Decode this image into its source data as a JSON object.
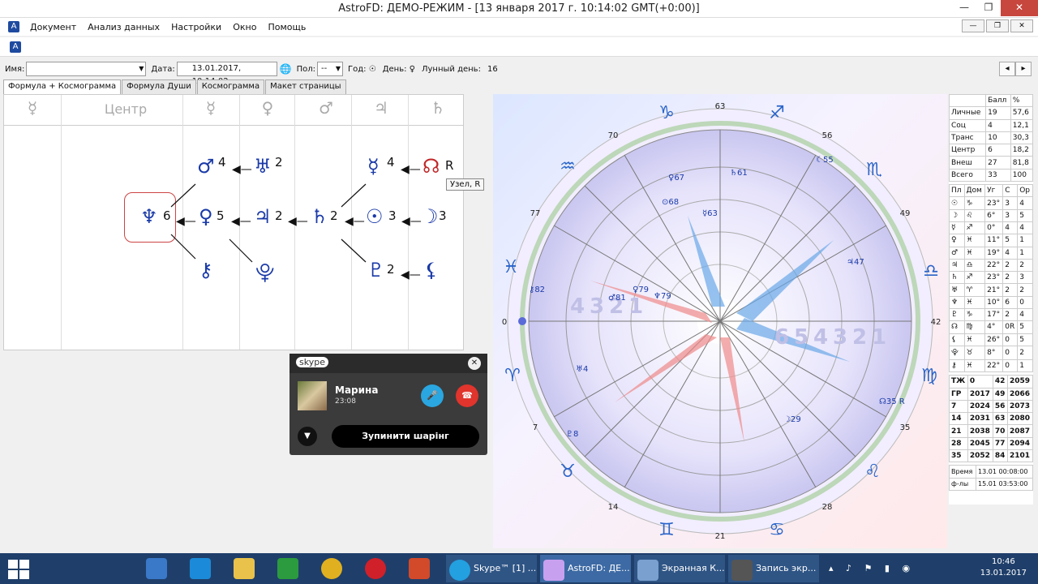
{
  "window": {
    "title": "AstroFD: ДЕМО-РЕЖИМ - [13 января 2017 г. 10:14:02 GMT(+0:00)]"
  },
  "menu": [
    "Документ",
    "Анализ данных",
    "Настройки",
    "Окно",
    "Помощь"
  ],
  "toolbar": {
    "name_label": "Имя:",
    "date_label": "Дата:",
    "date_value": "13.01.2017, 10:14:02",
    "sex_label": "Пол:",
    "sex_value": "--",
    "year_label": "Год: ☉",
    "day_label": "День: ♀",
    "lunar_label": "Лунный день:",
    "lunar_value": "16"
  },
  "tabs": [
    "Формула + Космограмма",
    "Формула Души",
    "Космограмма",
    "Макет страницы"
  ],
  "formula": {
    "columns": [
      "☿",
      "Центр",
      "☿",
      "♀",
      "♂",
      "♃",
      "♄"
    ],
    "nodes": [
      {
        "glyph": "♂",
        "num": "4"
      },
      {
        "glyph": "♅",
        "num": "2"
      },
      {
        "glyph": "☿",
        "num": "4"
      },
      {
        "glyph": "☊",
        "num": "R"
      },
      {
        "glyph": "♆",
        "num": "6"
      },
      {
        "glyph": "♀",
        "num": "5"
      },
      {
        "glyph": "♃",
        "num": "2"
      },
      {
        "glyph": "♄",
        "num": "2"
      },
      {
        "glyph": "☉",
        "num": "3"
      },
      {
        "glyph": "☽",
        "num": "3"
      },
      {
        "glyph": "⚷",
        "num": ""
      },
      {
        "glyph": "⯓",
        "num": ""
      },
      {
        "glyph": "♇",
        "num": "2"
      },
      {
        "glyph": "⚸",
        "num": ""
      }
    ],
    "tooltip": "Узел, R"
  },
  "skype": {
    "logo": "skype",
    "name": "Марина",
    "time": "23:08",
    "stop_button": "Зупинити шарінг"
  },
  "chart": {
    "ascendant_marks": [
      "63",
      "56",
      "49",
      "42",
      "35",
      "28",
      "21",
      "14",
      "7",
      "0",
      "77",
      "70"
    ],
    "house_digits_left": [
      "4",
      "3",
      "2",
      "1",
      "2",
      "3"
    ],
    "house_digits_right": [
      "6",
      "5",
      "4",
      "3",
      "2",
      "1"
    ],
    "planet_labels": [
      "♀67",
      "♄61",
      "⊙68",
      "☿63",
      "☾55",
      "⚷82",
      "♂81",
      "♀79",
      "♆79",
      "♃47",
      "♅4",
      "♇8",
      "☽29",
      "☊35 R"
    ]
  },
  "stats": {
    "headers": [
      "",
      "Балл",
      "%"
    ],
    "rows": [
      [
        "Личные",
        "19",
        "57,6"
      ],
      [
        "Соц",
        "4",
        "12,1"
      ],
      [
        "Транс",
        "10",
        "30,3"
      ],
      [
        "Центр",
        "6",
        "18,2"
      ],
      [
        "Внеш",
        "27",
        "81,8"
      ],
      [
        "Всего",
        "33",
        "100"
      ]
    ]
  },
  "planets": {
    "headers": [
      "Пл",
      "Дом",
      "Уг",
      "С",
      "Ор"
    ],
    "rows": [
      [
        "☉",
        "♑",
        "23°",
        "3",
        "4"
      ],
      [
        "☽",
        "♌",
        "6°",
        "3",
        "5"
      ],
      [
        "☿",
        "♐",
        "0°",
        "4",
        "4"
      ],
      [
        "♀",
        "♓",
        "11°",
        "5",
        "1"
      ],
      [
        "♂",
        "♓",
        "19°",
        "4",
        "1"
      ],
      [
        "♃",
        "♎",
        "22°",
        "2",
        "2"
      ],
      [
        "♄",
        "♐",
        "23°",
        "2",
        "3"
      ],
      [
        "♅",
        "♈",
        "21°",
        "2",
        "2"
      ],
      [
        "♆",
        "♓",
        "10°",
        "6",
        "0"
      ],
      [
        "♇",
        "♑",
        "17°",
        "2",
        "4"
      ],
      [
        "☊",
        "♍",
        "4°",
        "0R",
        "5"
      ],
      [
        "⚸",
        "♓",
        "26°",
        "0",
        "5"
      ],
      [
        "⯓",
        "♉",
        "8°",
        "0",
        "2"
      ],
      [
        "⚷",
        "♓",
        "22°",
        "0",
        "1"
      ]
    ]
  },
  "years": {
    "rows": [
      [
        "ТЖ",
        "0",
        "42",
        "2059"
      ],
      [
        "ГР",
        "2017",
        "49",
        "2066"
      ],
      [
        "7",
        "2024",
        "56",
        "2073"
      ],
      [
        "14",
        "2031",
        "63",
        "2080"
      ],
      [
        "21",
        "2038",
        "70",
        "2087"
      ],
      [
        "28",
        "2045",
        "77",
        "2094"
      ],
      [
        "35",
        "2052",
        "84",
        "2101"
      ]
    ]
  },
  "footer": {
    "time_label": "Время",
    "time_value": "13.01 00:08:00",
    "fl_label": "ф-лы",
    "fl_value": "15.01 03:53:00"
  },
  "taskbar": {
    "items": [
      "Skype™ [1] ...",
      "AstroFD: ДЕ...",
      "Экранная К...",
      "Запись экр..."
    ],
    "clock_time": "10:46",
    "clock_date": "13.01.2017"
  }
}
